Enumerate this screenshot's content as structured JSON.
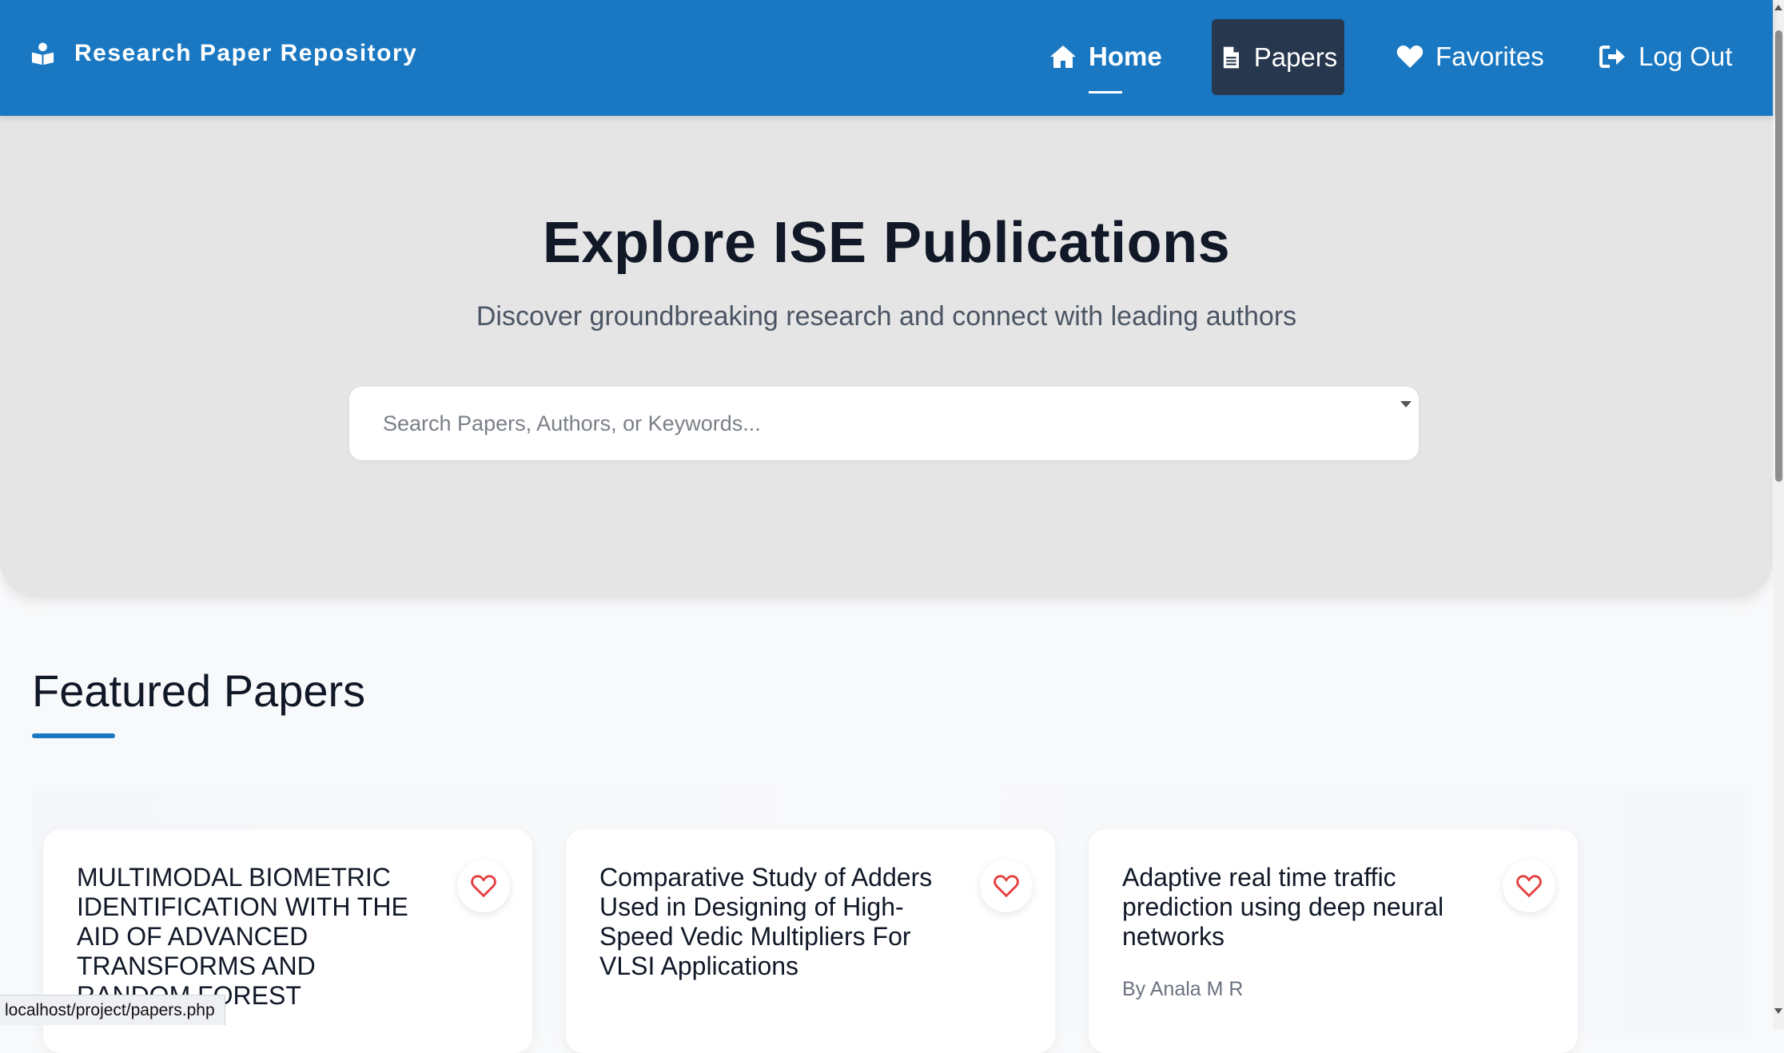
{
  "navbar": {
    "brand": "Research Paper Repository",
    "items": [
      {
        "label": "Home",
        "icon": "home-icon",
        "active": true
      },
      {
        "label": "Papers",
        "icon": "document-icon",
        "highlighted": true
      },
      {
        "label": "Favorites",
        "icon": "heart-icon"
      },
      {
        "label": "Log Out",
        "icon": "sign-out-icon"
      }
    ],
    "colors": {
      "bar": "#1a78c2",
      "highlight": "#27374d"
    }
  },
  "hero": {
    "title": "Explore ISE Publications",
    "subtitle": "Discover groundbreaking research and connect with leading authors",
    "search_placeholder": "Search Papers, Authors, or Keywords..."
  },
  "featured": {
    "title": "Featured Papers",
    "cards": [
      {
        "title": "MULTIMODAL BIOMETRIC IDENTIFICATION WITH THE AID OF ADVANCED TRANSFORMS AND RANDOM FOREST",
        "author": ""
      },
      {
        "title": "Comparative Study of Adders Used in Designing of High-Speed Vedic Multipliers For VLSI Applications",
        "author": ""
      },
      {
        "title": "Adaptive real time traffic prediction using deep neural networks",
        "author": "By Anala M R"
      }
    ]
  },
  "status_url": "localhost/project/papers.php"
}
